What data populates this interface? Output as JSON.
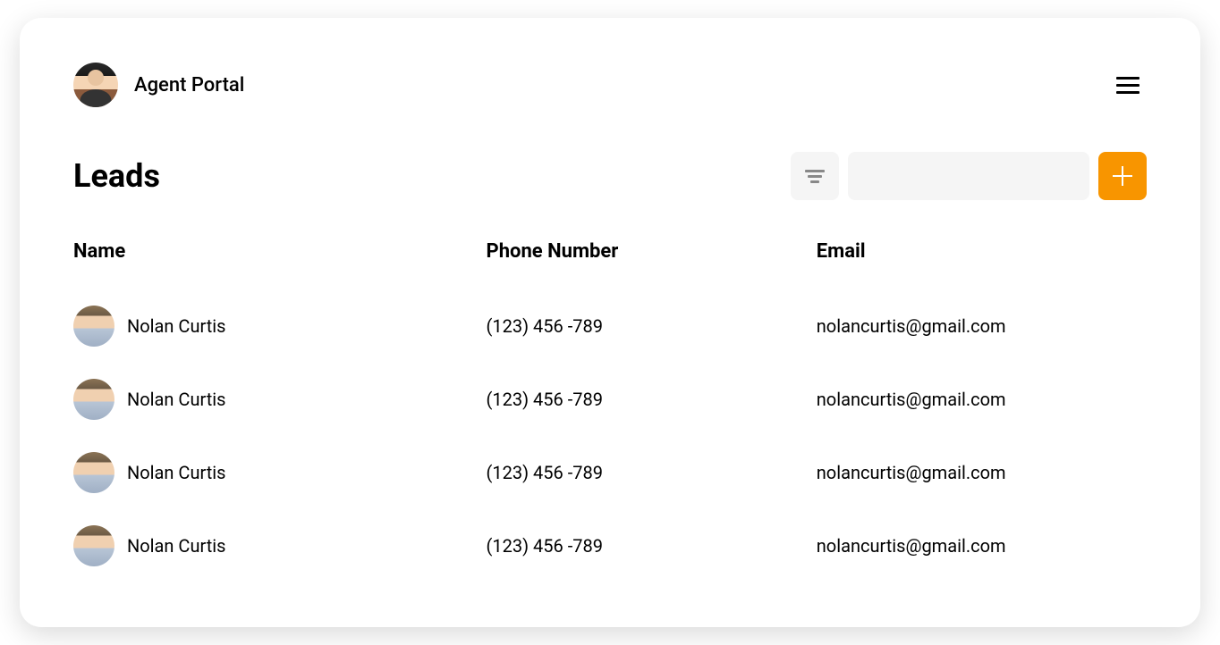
{
  "header": {
    "title": "Agent Portal"
  },
  "page": {
    "title": "Leads"
  },
  "search": {
    "placeholder": ""
  },
  "table": {
    "columns": {
      "name": "Name",
      "phone": "Phone Number",
      "email": "Email"
    },
    "rows": [
      {
        "name": "Nolan Curtis",
        "phone": "(123) 456 -789",
        "email": "nolancurtis@gmail.com"
      },
      {
        "name": "Nolan Curtis",
        "phone": "(123) 456 -789",
        "email": "nolancurtis@gmail.com"
      },
      {
        "name": "Nolan Curtis",
        "phone": "(123) 456 -789",
        "email": "nolancurtis@gmail.com"
      },
      {
        "name": "Nolan Curtis",
        "phone": "(123) 456 -789",
        "email": "nolancurtis@gmail.com"
      }
    ]
  }
}
